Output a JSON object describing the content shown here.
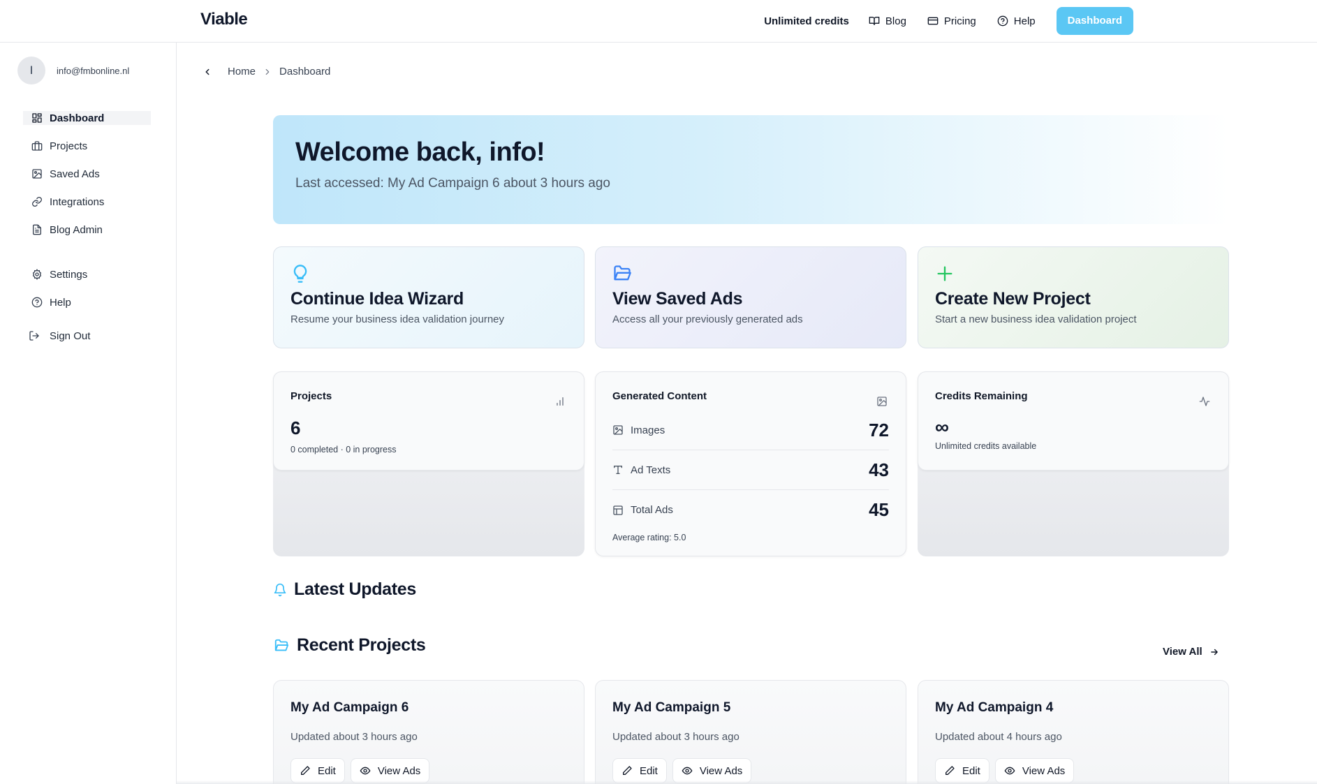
{
  "header": {
    "logo": "Viable",
    "credits": "Unlimited credits",
    "nav": {
      "blog": "Blog",
      "pricing": "Pricing",
      "help": "Help"
    },
    "dashboard_button": "Dashboard",
    "accent": "#5bc7f4"
  },
  "sidebar": {
    "avatar_initial": "I",
    "user_email": "info@fmbonline.nl",
    "items": [
      {
        "label": "Dashboard",
        "icon": "grid-icon"
      },
      {
        "label": "Projects",
        "icon": "briefcase-icon"
      },
      {
        "label": "Saved Ads",
        "icon": "image-icon"
      },
      {
        "label": "Integrations",
        "icon": "link-icon"
      },
      {
        "label": "Blog Admin",
        "icon": "document-icon"
      },
      {
        "label": "Settings",
        "icon": "gear-icon"
      },
      {
        "label": "Help",
        "icon": "help-circle-icon"
      }
    ],
    "sign_out": "Sign Out"
  },
  "breadcrumb": {
    "home": "Home",
    "current": "Dashboard"
  },
  "welcome": {
    "title": "Welcome back, info!",
    "subtitle": "Last accessed: My Ad Campaign 6 about 3 hours ago"
  },
  "actions": [
    {
      "title": "Continue Idea Wizard",
      "description": "Resume your business idea validation journey",
      "icon": "lightbulb-icon",
      "color": "#38bdf8"
    },
    {
      "title": "View Saved Ads",
      "description": "Access all your previously generated ads",
      "icon": "folder-open-icon",
      "color": "#3b82f6"
    },
    {
      "title": "Create New Project",
      "description": "Start a new business idea validation project",
      "icon": "plus-icon",
      "color": "#22c55e"
    }
  ],
  "stats": {
    "projects": {
      "title": "Projects",
      "value": "6",
      "sub": "0 completed · 0 in progress"
    },
    "generated": {
      "title": "Generated Content",
      "rows": [
        {
          "label": "Images",
          "value": "72"
        },
        {
          "label": "Ad Texts",
          "value": "43"
        },
        {
          "label": "Total Ads",
          "value": "45"
        }
      ],
      "rating": "Average rating: 5.0"
    },
    "credits": {
      "title": "Credits Remaining",
      "value": "∞",
      "sub": "Unlimited credits available"
    }
  },
  "updates": {
    "title": "Latest Updates"
  },
  "recent": {
    "title": "Recent Projects",
    "view_all": "View All",
    "projects": [
      {
        "name": "My Ad Campaign 6",
        "updated": "Updated about 3 hours ago",
        "edit": "Edit",
        "view": "View Ads"
      },
      {
        "name": "My Ad Campaign 5",
        "updated": "Updated about 3 hours ago",
        "edit": "Edit",
        "view": "View Ads"
      },
      {
        "name": "My Ad Campaign 4",
        "updated": "Updated about 4 hours ago",
        "edit": "Edit",
        "view": "View Ads"
      }
    ]
  }
}
